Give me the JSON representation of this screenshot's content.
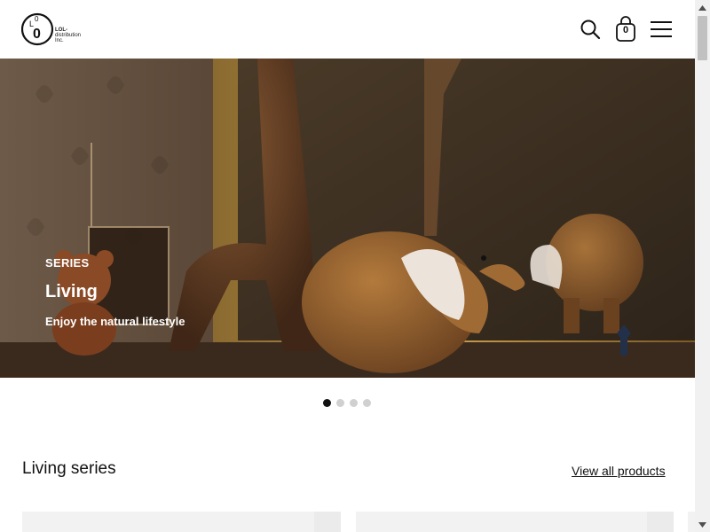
{
  "header": {
    "logo_lines": [
      "LOL-",
      "distribution",
      "Inc."
    ],
    "cart_count": "0",
    "icons": [
      "search-icon",
      "shopping-bag-icon",
      "hamburger-menu-icon"
    ]
  },
  "hero": {
    "kicker": "SERIES",
    "title": "Living",
    "subtitle": "Enjoy the natural lifestyle",
    "slides_total": 4,
    "active_slide": 1
  },
  "section": {
    "title": "Living series",
    "view_all_label": "View all products"
  },
  "colors": {
    "accent": "#111111",
    "hero_text": "#ffffff",
    "dot_inactive": "#d0d0d0"
  }
}
